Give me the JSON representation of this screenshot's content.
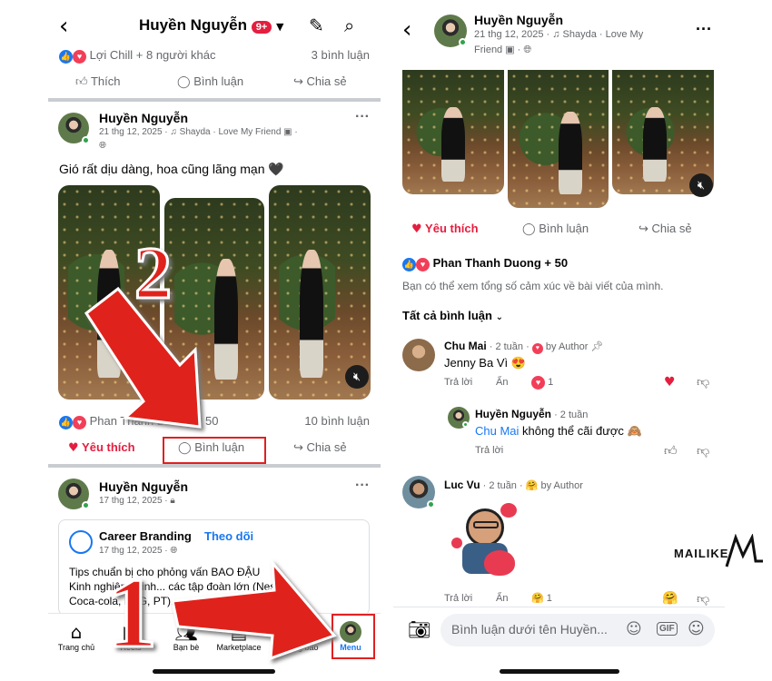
{
  "left": {
    "header": {
      "title": "Huyền Nguyễn",
      "badge": "9+"
    },
    "top_post": {
      "reactions": "Lợi Chill + 8 người khác",
      "comments": "3 bình luận",
      "like": "Thích",
      "comment": "Bình luận",
      "share": "Chia sẻ"
    },
    "post": {
      "author": "Huyền Nguyễn",
      "meta": "21 thg 12, 2025 · ♫ Shayda · Love My Friend ▣ ·",
      "caption": "Gió rất dịu dàng, hoa cũng lãng mạn 🖤",
      "reactions": "Phan Thanh Duong + 50",
      "comments": "10 bình luận",
      "love": "Yêu thích",
      "comment": "Bình luận",
      "share": "Chia sẻ"
    },
    "post2": {
      "author": "Huyền Nguyễn",
      "meta": "17 thg 12, 2025 ·",
      "page_name": "Career Branding",
      "follow": "Theo dõi",
      "page_meta": "17 thg 12, 2025 ·",
      "line1": "Tips chuẩn bị cho phỏng vấn BAO ĐẬU",
      "line2": "Kinh nghiệm thinh... các tập đoàn lớn (Nestlé,",
      "line3": "Coca-cola, P&G, PT)."
    },
    "tabs": [
      "Trang chủ",
      "Reels",
      "Bạn bè",
      "Marketplace",
      "Thông báo",
      "Menu"
    ],
    "overlay": {
      "step1": "1",
      "step2": "2"
    }
  },
  "right": {
    "header": {
      "author": "Huyền Nguyễn",
      "meta1": "21 thg 12, 2025 · ♫ Shayda · Love My",
      "meta2": "Friend ▣ ·"
    },
    "actions": {
      "love": "Yêu thích",
      "comment": "Bình luận",
      "share": "Chia sẻ"
    },
    "reaction_summary": "Phan Thanh Duong + 50",
    "reaction_note": "Bạn có thể xem tổng số cảm xúc về bài viết của mình.",
    "filter": "Tất cả bình luận",
    "comments": [
      {
        "name": "Chu Mai",
        "time": "· 2 tuần ·",
        "by": "by Author",
        "text": "Jenny Ba Vì 😍",
        "reply": "Trả lời",
        "hide": "Ẩn",
        "count": "1"
      },
      {
        "name": "Huyền Nguyễn",
        "time": "· 2 tuần",
        "mention": "Chu Mai",
        "text": " không thể cãi được 🙈",
        "reply": "Trả lời"
      },
      {
        "name": "Luc Vu",
        "time": "· 2 tuần ·",
        "by": "by Author",
        "reply": "Trả lời",
        "hide": "Ẩn",
        "count": "1"
      }
    ],
    "composer_placeholder": "Bình luận dưới tên Huyền...",
    "gif": "GIF",
    "watermark": "MAILIKE"
  },
  "colors": {
    "accent": "#1877f2",
    "love": "#e41e3f",
    "online": "#31a24c",
    "arrow": "#e0201a"
  }
}
